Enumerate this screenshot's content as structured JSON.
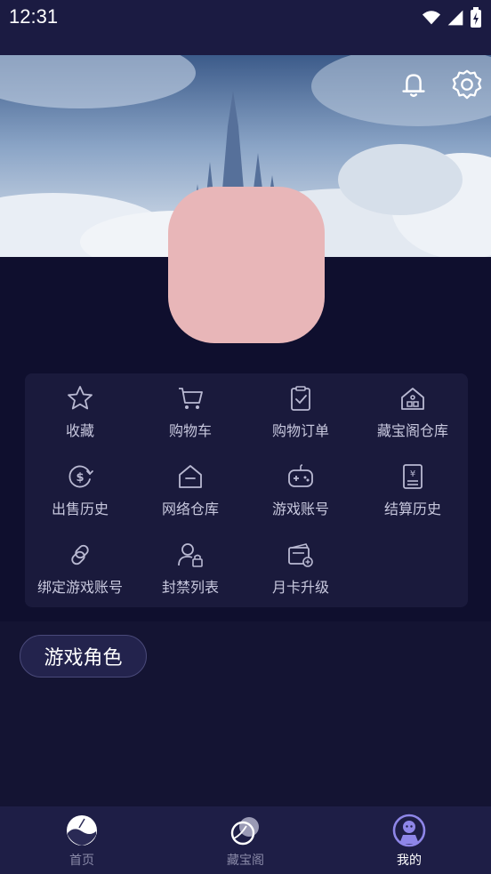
{
  "status_bar": {
    "time": "12:31",
    "icons": [
      "wifi-icon",
      "signal-icon",
      "battery-icon"
    ]
  },
  "header": {
    "actions": [
      "bell-icon",
      "gear-icon"
    ]
  },
  "profile": {
    "avatar": "avatar"
  },
  "menu": {
    "items": [
      {
        "label": "收藏",
        "icon": "star-icon"
      },
      {
        "label": "购物车",
        "icon": "cart-icon"
      },
      {
        "label": "购物订单",
        "icon": "order-icon"
      },
      {
        "label": "藏宝阁仓库",
        "icon": "house-icon"
      },
      {
        "label": "出售历史",
        "icon": "sell-history-icon"
      },
      {
        "label": "网络仓库",
        "icon": "warehouse-icon"
      },
      {
        "label": "游戏账号",
        "icon": "gamepad-icon"
      },
      {
        "label": "结算历史",
        "icon": "receipt-icon"
      },
      {
        "label": "绑定游戏账号",
        "icon": "link-icon"
      },
      {
        "label": "封禁列表",
        "icon": "user-lock-icon"
      },
      {
        "label": "月卡升级",
        "icon": "card-upgrade-icon"
      }
    ]
  },
  "section": {
    "chip_label": "游戏角色"
  },
  "bottom_nav": {
    "items": [
      {
        "label": "首页",
        "icon": "home-icon"
      },
      {
        "label": "藏宝阁",
        "icon": "treasure-icon"
      },
      {
        "label": "我的",
        "icon": "profile-icon",
        "active": true
      }
    ]
  },
  "colors": {
    "background": "#141433",
    "card": "#1a1a3c",
    "avatar": "#e8b6b8",
    "nav": "#1e1e46"
  }
}
